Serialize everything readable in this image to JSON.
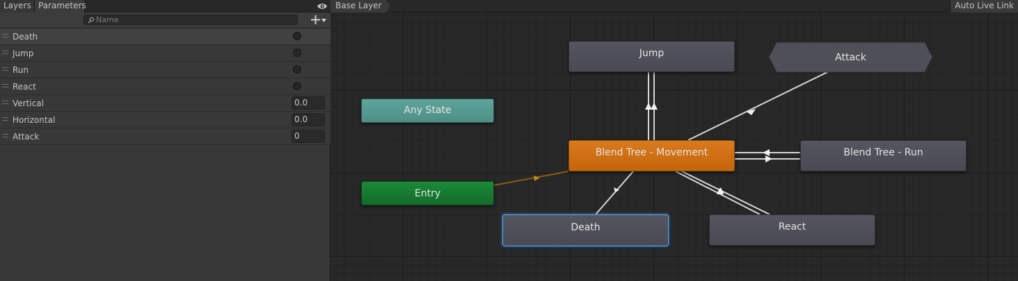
{
  "tabs": {
    "layers": "Layers",
    "parameters": "Parameters"
  },
  "search": {
    "placeholder": "Name",
    "value": ""
  },
  "parameters": [
    {
      "name": "Death",
      "type": "trigger"
    },
    {
      "name": "Jump",
      "type": "trigger"
    },
    {
      "name": "Run",
      "type": "trigger"
    },
    {
      "name": "React",
      "type": "trigger"
    },
    {
      "name": "Vertical",
      "type": "float",
      "value": "0.0"
    },
    {
      "name": "Horizontal",
      "type": "float",
      "value": "0.0"
    },
    {
      "name": "Attack",
      "type": "int",
      "value": "0"
    }
  ],
  "graph": {
    "breadcrumb": "Base Layer",
    "auto_live_link": "Auto Live Link",
    "states": {
      "jump": "Jump",
      "attack": "Attack",
      "any_state": "Any State",
      "blend_movement": "Blend Tree - Movement",
      "blend_run": "Blend Tree - Run",
      "entry": "Entry",
      "death": "Death",
      "react": "React"
    }
  },
  "colors": {
    "default_state": "#4f4f57",
    "default_state_layer": "#d2720f",
    "any_state": "#56998f",
    "entry": "#167a30",
    "selected_outline": "#5aa8ef",
    "transition": "#d6d6d6",
    "entry_transition": "#8b5e10"
  }
}
